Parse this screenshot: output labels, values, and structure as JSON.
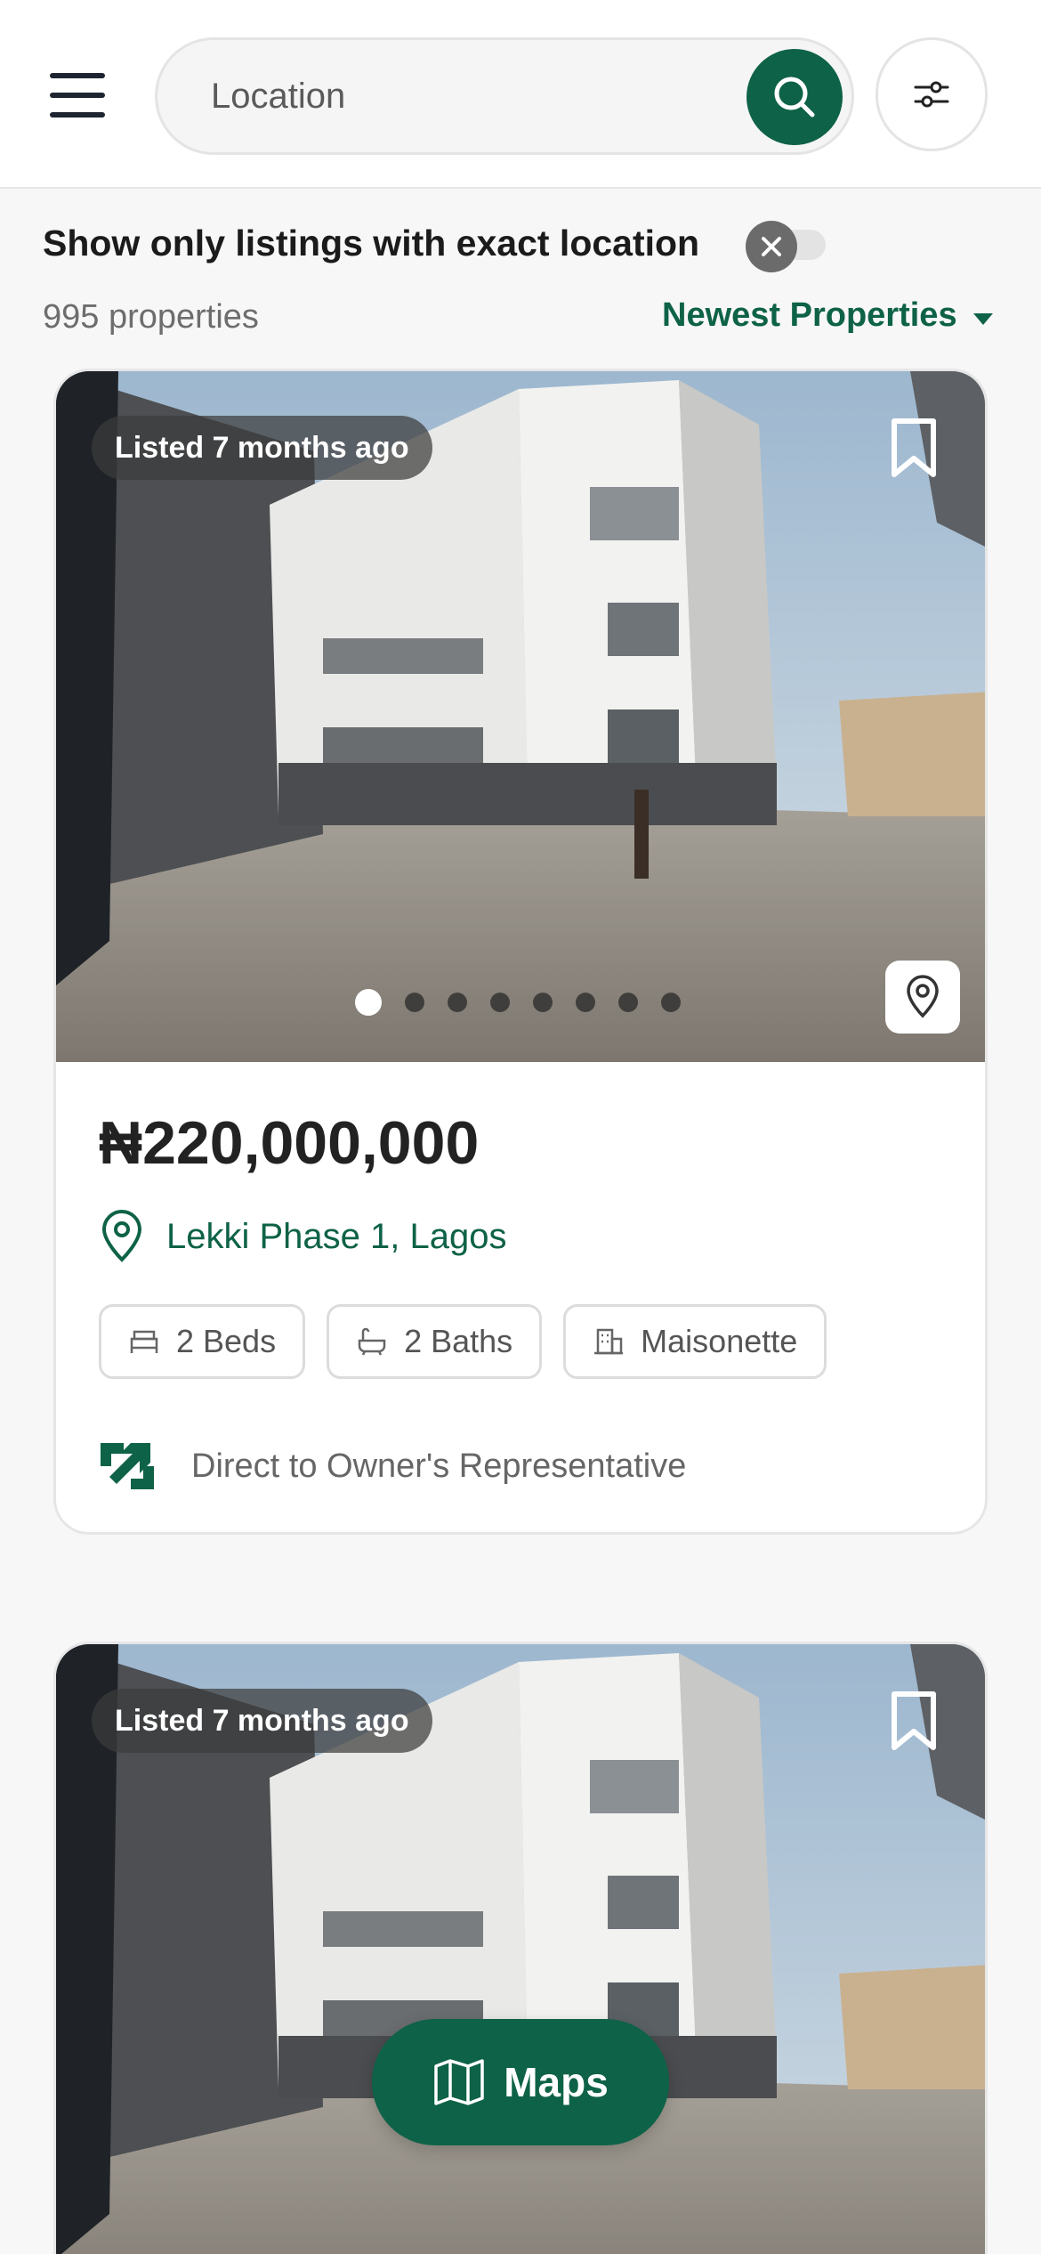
{
  "header": {
    "search_placeholder": "Location",
    "icons": {
      "menu": "hamburger-icon",
      "search": "search-icon",
      "filter": "sliders-icon"
    }
  },
  "filters": {
    "exact_location_label": "Show only listings with exact location",
    "exact_location_enabled": false,
    "result_count": "995 properties",
    "sort_label": "Newest Properties"
  },
  "listings": [
    {
      "listed": "Listed 7 months ago",
      "price": "₦220,000,000",
      "location": "Lekki Phase 1, Lagos",
      "beds": "2 Beds",
      "baths": "2 Baths",
      "type": "Maisonette",
      "owner": "Direct to Owner's Representative",
      "photo_count": 8,
      "active_photo": 1
    },
    {
      "listed": "Listed 7 months ago"
    }
  ],
  "maps_button": {
    "label": "Maps"
  },
  "colors": {
    "brand": "#0e6247",
    "text": "#1e1e1e",
    "muted": "#6d6d6d"
  }
}
